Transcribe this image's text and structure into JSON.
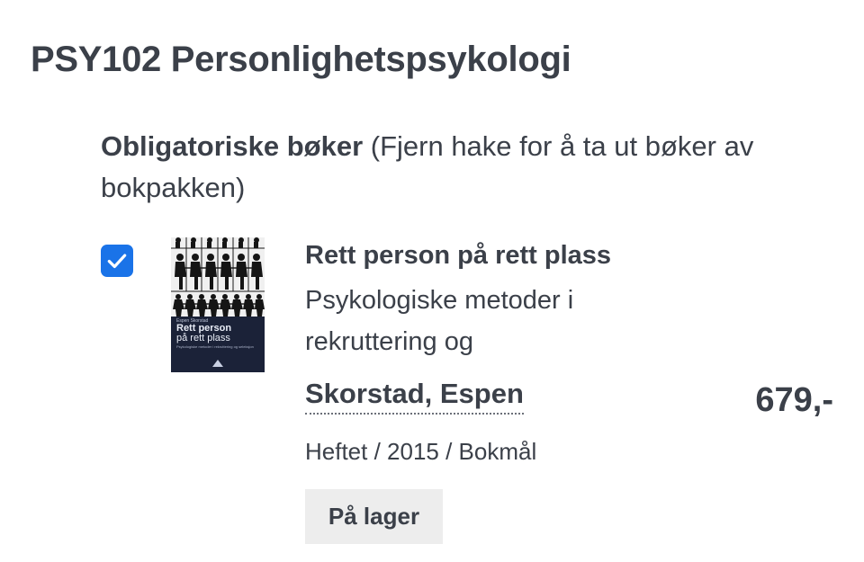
{
  "course": {
    "title": "PSY102 Personlighetspsykologi"
  },
  "section": {
    "heading_strong": "Obligatoriske bøker",
    "heading_note": " (Fjern hake for å ta ut bøker av bokpakken)"
  },
  "book": {
    "checked": true,
    "title": "Rett person på rett plass",
    "subtitle": "Psykologiske metoder i rekruttering og",
    "author": "Skorstad, Espen",
    "price": "679,-",
    "format_year_language": "Heftet / 2015 / Bokmål",
    "stock_status": "På lager",
    "cover": {
      "author": "Espen Skorstad",
      "title_line1": "Rett person",
      "title_line2": "på rett plass",
      "subtitle": "Psykologiske metoder i rekruttering og seleksjon",
      "background_color": "#1b2238"
    }
  },
  "colors": {
    "text": "#3b4049",
    "checkbox": "#1a73e8",
    "badge_bg": "#ededed"
  },
  "icons": {
    "checkbox": "checkmark-icon",
    "cover_logo": "publisher-logo"
  }
}
